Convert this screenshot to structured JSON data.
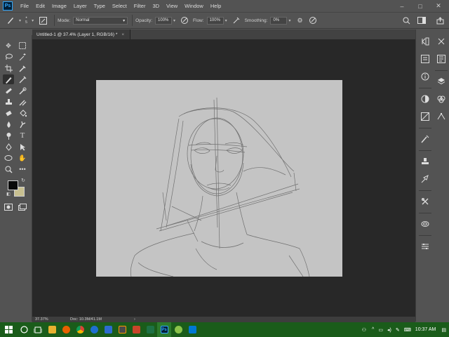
{
  "app": {
    "logo": "Ps"
  },
  "menubar": {
    "items": [
      "File",
      "Edit",
      "Image",
      "Layer",
      "Type",
      "Select",
      "Filter",
      "3D",
      "View",
      "Window",
      "Help"
    ]
  },
  "window_controls": {
    "minimize": "–",
    "maximize": "□",
    "close": "✕"
  },
  "options_bar": {
    "brush_size": "5",
    "mode_label": "Mode:",
    "mode_value": "Normal",
    "opacity_label": "Opacity:",
    "opacity_value": "100%",
    "flow_label": "Flow:",
    "flow_value": "100%",
    "smoothing_label": "Smoothing:",
    "smoothing_value": "0%"
  },
  "document": {
    "tab_title": "Untitled-1 @ 37.4% (Layer 1, RGB/16) *",
    "tab_close": "×"
  },
  "status_bar": {
    "zoom": "37.37%",
    "doc_info": "Doc: 10.3M/41.1M",
    "arrow": "›"
  },
  "colors": {
    "foreground": "#0a0a0a",
    "background": "#c8c090",
    "canvas": "#c4c4c4",
    "workspace": "#282828",
    "taskbar": "#1a5c1a"
  },
  "tools": [
    "move-tool",
    "artboard-tool",
    "lasso-tool",
    "magic-wand-tool",
    "crop-tool",
    "eyedropper-tool",
    "brush-tool",
    "pencil-tool",
    "healing-tool",
    "history-brush-tool",
    "stamp-tool",
    "mixer-brush-tool",
    "eraser-tool",
    "paint-bucket-tool",
    "blur-tool",
    "smudge-tool",
    "dodge-tool",
    "type-tool",
    "pen-tool",
    "path-select-tool",
    "ellipse-tool",
    "hand-tool",
    "zoom-tool",
    "more-tools"
  ],
  "taskbar": {
    "time": "10:37 AM"
  }
}
